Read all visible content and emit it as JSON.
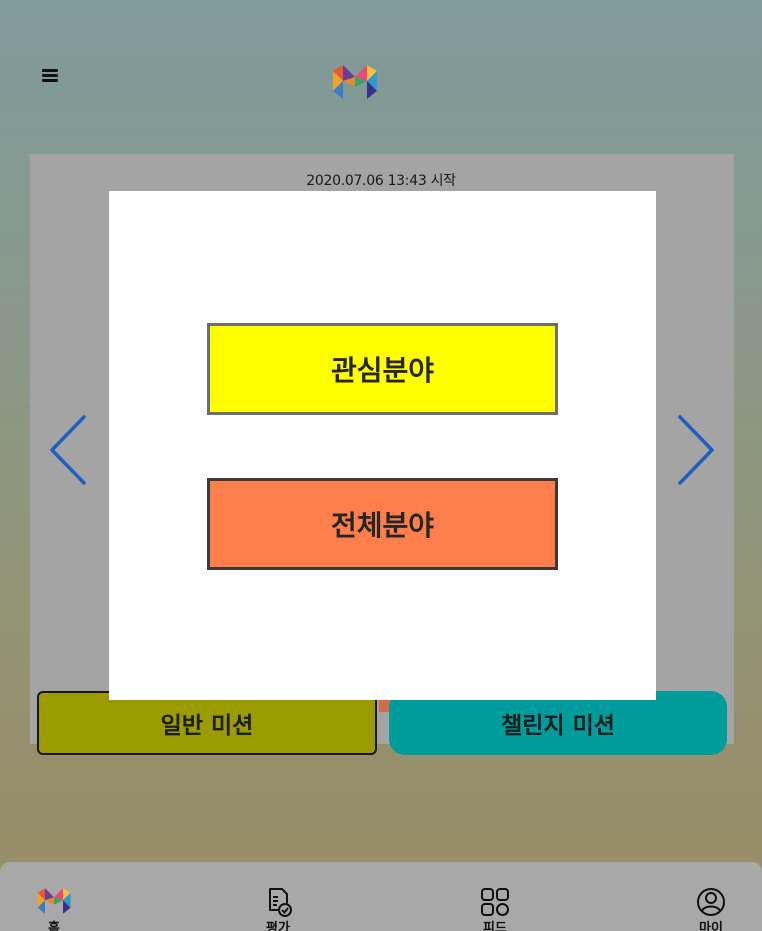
{
  "header": {
    "menu_icon": "hamburger-icon",
    "logo_icon": "m-logo-icon"
  },
  "mission_card": {
    "start_text": "2020.07.06 13:43 시작",
    "prev_icon": "chevron-left-icon",
    "next_icon": "chevron-right-icon",
    "general_mission_label": "일반 미션",
    "challenge_mission_label": "챌린지 미션"
  },
  "modal": {
    "interest_field_label": "관심분야",
    "all_fields_label": "전체분야"
  },
  "bottom_nav": {
    "items": [
      {
        "label": "홈",
        "icon": "m-logo-icon"
      },
      {
        "label": "평가",
        "icon": "evaluation-icon"
      },
      {
        "label": "피드",
        "icon": "feed-grid-icon"
      },
      {
        "label": "마이",
        "icon": "profile-icon"
      }
    ]
  },
  "colors": {
    "interest_button": "#ffff00",
    "all_fields_button": "#ff7f4c",
    "general_mission": "#9b9b00",
    "challenge_mission": "#009c9c",
    "arrow": "#1f5fbf"
  }
}
